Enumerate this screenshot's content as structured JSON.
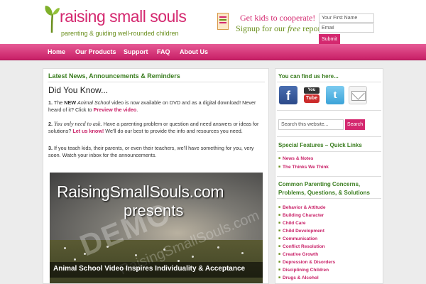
{
  "header": {
    "logo_title": "raising small souls",
    "logo_tagline": "parenting & guiding well-rounded children",
    "promo_line1": "Get kids to cooperate!",
    "promo_line2_before": "Signup for our ",
    "promo_line2_free": "free",
    "promo_line2_after": " report.",
    "signup": {
      "name_placeholder": "Your First Name",
      "email_placeholder": "Email",
      "submit_label": "Submit"
    }
  },
  "nav": {
    "items": [
      "Home",
      "Our Products",
      "Support",
      "FAQ",
      "About Us"
    ]
  },
  "main": {
    "heading": "Latest News, Announcements & Reminders",
    "subheading": "Did You Know...",
    "p1": {
      "num": "1.",
      "t1": " The ",
      "new": "NEW",
      "t2": " ",
      "italic": "Animal School",
      "t3": " video is now available on DVD and as a digital download! Never heard of it? Click to ",
      "link": "Preview the video",
      "t4": "."
    },
    "p2": {
      "num": "2.",
      "italic": "You only need to ask.",
      "t1": " Have a parenting problem or question and need answers or ideas for solutions? ",
      "link": "Let us know!",
      "t2": " We'll do our best to provide the info and resources you need."
    },
    "p3": {
      "num": "3.",
      "text": " If you teach kids, their parents, or even their teachers, we'll have something for you, very soon. Watch your inbox for the announcements."
    },
    "video": {
      "title": "RaisingSmallSouls.com",
      "presents": "presents",
      "watermark": "DEMO",
      "watermark_sub": "RaisingSmallSouls.com",
      "caption": "Animal School Video Inspires Individuality & Acceptance"
    }
  },
  "sidebar": {
    "find_heading": "You can find us here...",
    "social": [
      "facebook-icon",
      "youtube-icon",
      "twitter-icon",
      "email-icon"
    ],
    "youtube_top": "You",
    "youtube_bottom": "Tube",
    "facebook_letter": "f",
    "twitter_letter": "t",
    "search_placeholder": "Search this website...",
    "search_button": "Search",
    "features_heading": "Special Features – Quick Links",
    "features": [
      "News & Notes",
      "The Thinks We Think"
    ],
    "concerns_heading_1": "Common Parenting Concerns,",
    "concerns_heading_2": "Problems, Questions, & Solutions",
    "concerns": [
      "Behavior & Attitude",
      "Building Character",
      "Child Care",
      "Child Development",
      "Communication",
      "Conflict Resolution",
      "Creative Growth",
      "Depression & Disorders",
      "Disciplining Children",
      "Drugs & Alcohol"
    ]
  },
  "colors": {
    "brand_pink": "#d4286f",
    "brand_green": "#6a8f1d",
    "heading_green": "#3a7d1f"
  }
}
